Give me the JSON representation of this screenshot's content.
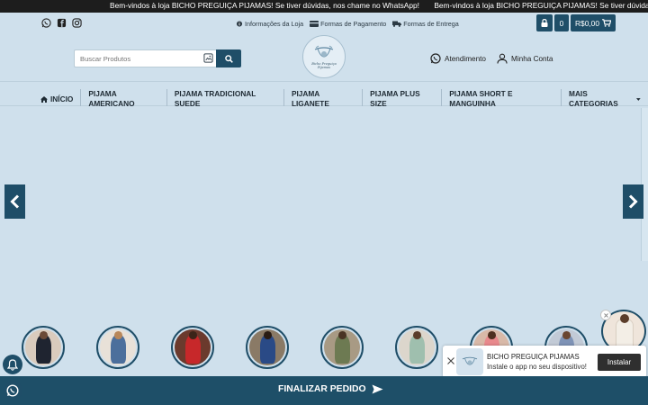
{
  "announcement": {
    "messages": [
      "Bem-vindos à loja BICHO PREGUIÇA PIJAMAS! Se tiver dúvidas, nos chame no WhatsApp!",
      "Bem-vindos à loja BICHO PREGUIÇA PIJAMAS! Se tiver dúvidas, nos chame no W"
    ]
  },
  "social": {
    "icons": [
      "whatsapp-icon",
      "facebook-icon",
      "instagram-icon"
    ]
  },
  "info_links": {
    "store_info": "Informações da Loja",
    "payment": "Formas de Pagamento",
    "delivery": "Formas de Entrega"
  },
  "cart": {
    "count": "0",
    "total": "R$0,00"
  },
  "search": {
    "placeholder": "Buscar Produtos"
  },
  "logo": {
    "line1": "Bicho Preguiça",
    "line2": "Pijamas"
  },
  "account": {
    "support": "Atendimento",
    "my_account": "Minha Conta"
  },
  "nav": {
    "items": [
      "INÍCIO",
      "PIJAMA AMERICANO",
      "PIJAMA TRADICIONAL SUEDE",
      "PIJAMA LIGANETE",
      "PIJAMA PLUS SIZE",
      "PIJAMA SHORT E MANGUINHA",
      "MAIS CATEGORIAS"
    ]
  },
  "install_prompt": {
    "title": "BICHO PREGUIÇA PIJAMAS",
    "message": "Instale o app no seu dispositivo!",
    "button": "Instalar"
  },
  "checkout": {
    "label": "FINALIZAR PEDIDO"
  },
  "colors": {
    "primary": "#1f4e68",
    "background": "#cfe0ec",
    "topbar": "#1d1d1d"
  }
}
